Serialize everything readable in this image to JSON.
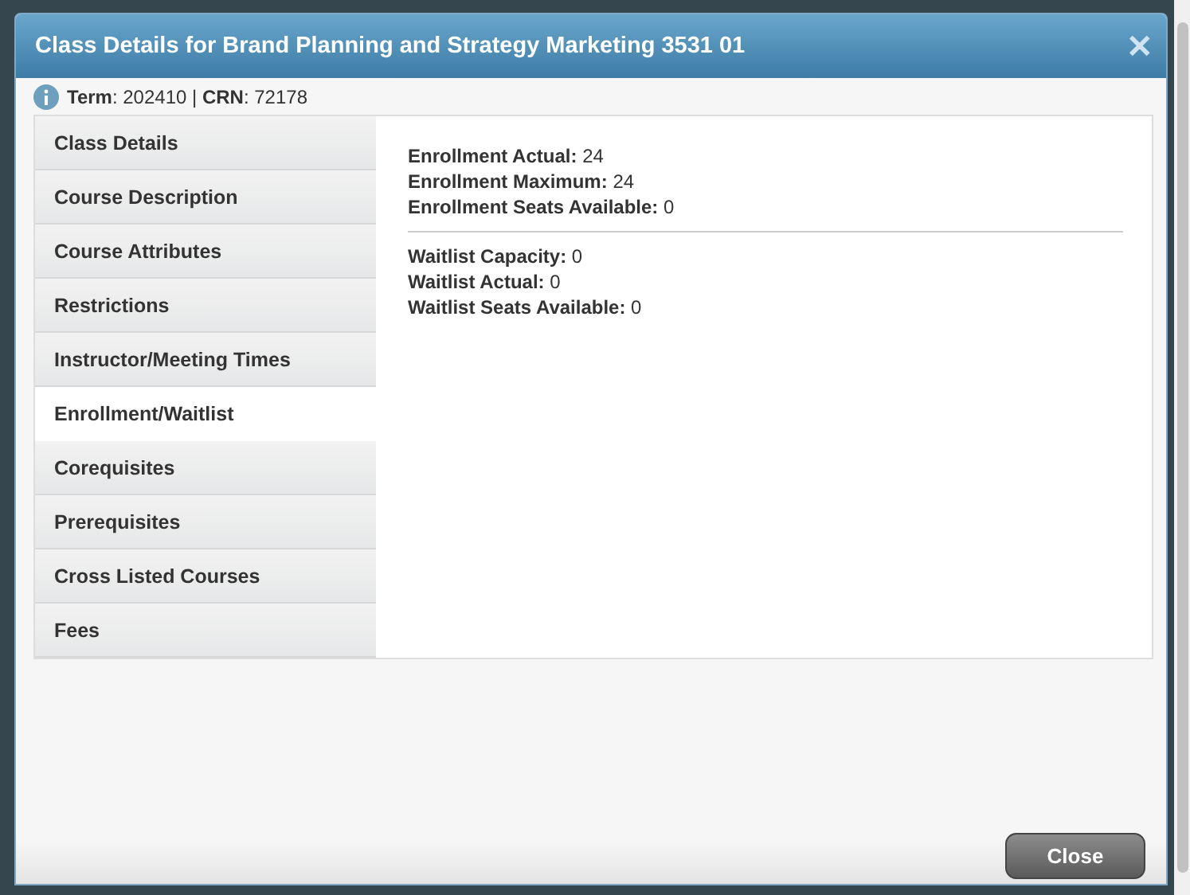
{
  "dialog": {
    "title": "Class Details for Brand Planning and Strategy Marketing 3531 01",
    "close_icon": "✕"
  },
  "info": "**Term**: 202410 | **CRN**: 72178",
  "tabs": [
    {
      "label": "Class Details",
      "selected": false
    },
    {
      "label": "Course Description",
      "selected": false
    },
    {
      "label": "Course Attributes",
      "selected": false
    },
    {
      "label": "Restrictions",
      "selected": false
    },
    {
      "label": "Instructor/Meeting Times",
      "selected": false
    },
    {
      "label": "Enrollment/Waitlist",
      "selected": true
    },
    {
      "label": "Corequisites",
      "selected": false
    },
    {
      "label": "Prerequisites",
      "selected": false
    },
    {
      "label": "Cross Listed Courses",
      "selected": false
    },
    {
      "label": "Fees",
      "selected": false
    }
  ],
  "groups": [
    [
      "**Enrollment Actual:** 24",
      "**Enrollment Maximum:** 24",
      "**Enrollment Seats Available:** 0"
    ],
    [
      "**Waitlist Capacity:** 0",
      "**Waitlist Actual:** 0",
      "**Waitlist Seats Available:** 0"
    ]
  ],
  "buttons": [
    "Close"
  ]
}
